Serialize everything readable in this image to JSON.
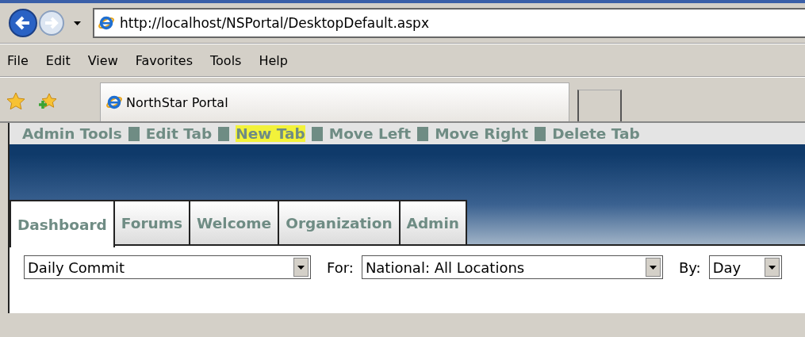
{
  "browser": {
    "address": "http://localhost/NSPortal/DesktopDefault.aspx",
    "menu": [
      "File",
      "Edit",
      "View",
      "Favorites",
      "Tools",
      "Help"
    ],
    "tab_title": "NorthStar Portal"
  },
  "admin_links": [
    {
      "label": "Admin Tools",
      "highlighted": false
    },
    {
      "label": "Edit Tab",
      "highlighted": false
    },
    {
      "label": "New Tab",
      "highlighted": true
    },
    {
      "label": "Move Left",
      "highlighted": false
    },
    {
      "label": "Move Right",
      "highlighted": false
    },
    {
      "label": "Delete Tab",
      "highlighted": false
    }
  ],
  "tabs": [
    {
      "label": "Dashboard",
      "selected": true
    },
    {
      "label": "Forums",
      "selected": false
    },
    {
      "label": "Welcome",
      "selected": false
    },
    {
      "label": "Organization",
      "selected": false
    },
    {
      "label": "Admin",
      "selected": false
    }
  ],
  "filters": [
    {
      "value": "Daily Commit"
    },
    {
      "label": "For:",
      "value": "National: All Locations"
    },
    {
      "label": "By:",
      "value": "Day"
    }
  ]
}
